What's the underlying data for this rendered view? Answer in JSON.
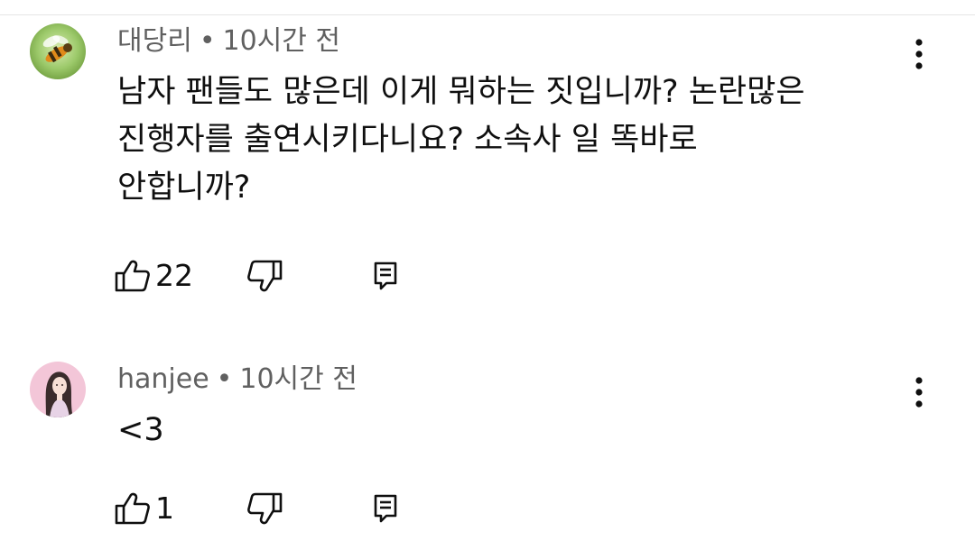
{
  "comments": [
    {
      "author": "대당리",
      "separator": "•",
      "time": "10시간 전",
      "text_lines": [
        "남자 팬들도 많은데 이게 뭐하는 짓입니까?  논란많은",
        "진행자를 출연시키다니요? 소속사 일 똑바로",
        "안합니까?"
      ],
      "likes": "22",
      "avatar": "bee-avatar",
      "icons": {
        "like": "thumbs-up-icon",
        "dislike": "thumbs-down-icon",
        "reply": "reply-icon",
        "menu": "more-vert-icon"
      }
    },
    {
      "author": "hanjee",
      "separator": "•",
      "time": "10시간 전",
      "text_lines": [
        "<3"
      ],
      "likes": "1",
      "avatar": "illustrated-woman-avatar",
      "icons": {
        "like": "thumbs-up-icon",
        "dislike": "thumbs-down-icon",
        "reply": "reply-icon",
        "menu": "more-vert-icon"
      }
    }
  ],
  "colors": {
    "meta_text": "#606060",
    "body_text": "#0f0f0f",
    "avatar1_bg": "#8fbf5a",
    "avatar2_bg": "#f3c6d8"
  }
}
